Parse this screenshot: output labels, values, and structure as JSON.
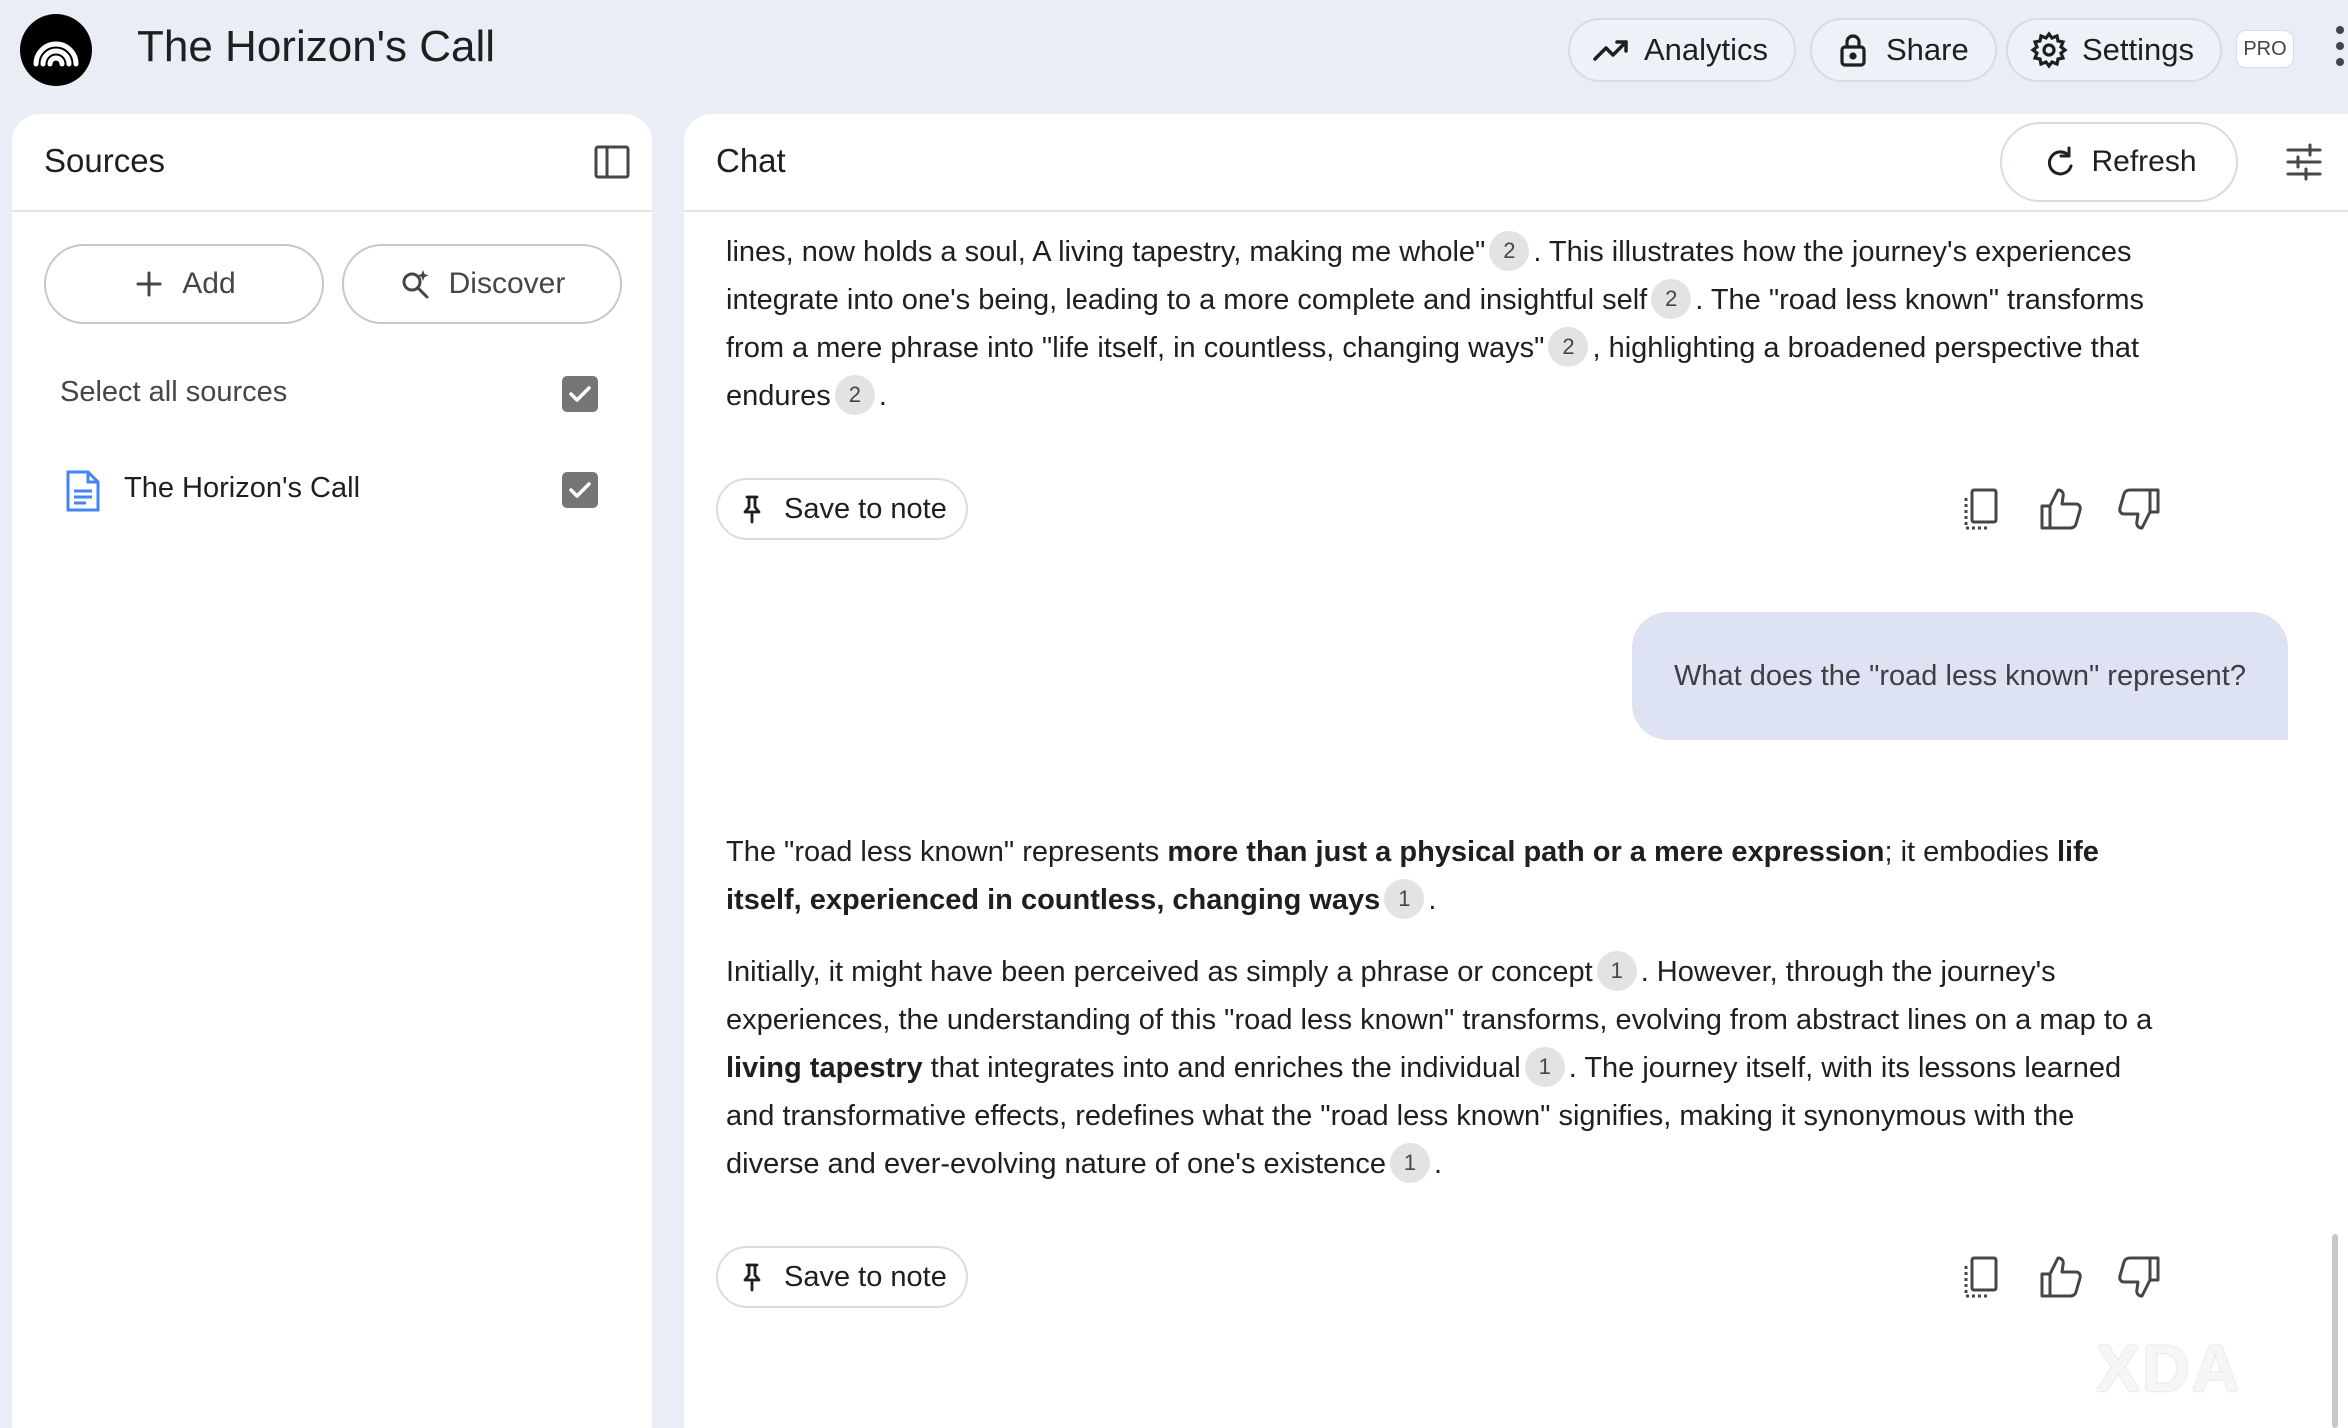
{
  "app": {
    "title": "The Horizon's Call",
    "logo_icon": "notebook-waves-logo"
  },
  "header": {
    "analytics_label": "Analytics",
    "share_label": "Share",
    "settings_label": "Settings",
    "pro_badge": "PRO"
  },
  "sources": {
    "title": "Sources",
    "add_label": "Add",
    "discover_label": "Discover",
    "select_all_label": "Select all sources",
    "select_all_checked": true,
    "items": [
      {
        "label": "The Horizon's Call",
        "checked": true,
        "icon": "document-icon"
      }
    ]
  },
  "chat": {
    "title": "Chat",
    "refresh_label": "Refresh",
    "prev_answer": {
      "t1": "lines, now holds a soul, A living tapestry, making me whole\"",
      "c1": "2",
      "t2": ". This illustrates how the journey's experiences integrate into one's being, leading to a more complete and insightful self",
      "c2": "2",
      "t3": ". The \"road less known\" transforms from a mere phrase into \"life itself, in countless, changing ways\"",
      "c3": "2",
      "t4": ", highlighting a broadened perspective that endures",
      "c4": "2",
      "t5": "."
    },
    "save_to_note_label": "Save to note",
    "user_question": "What does the \"road less known\" represent?",
    "answer_p1": {
      "t1": "The \"road less known\" represents ",
      "b1": "more than just a physical path or a mere expression",
      "t2": "; it embodies ",
      "b2": "life itself, experienced in countless, changing ways",
      "c1": "1",
      "t3": "."
    },
    "answer_p2": {
      "t1": "Initially, it might have been perceived as simply a phrase or concept",
      "c1": "1",
      "t2": ". However, through the journey's experiences, the understanding of this \"road less known\" transforms, evolving from abstract lines on a map to a ",
      "b1": "living tapestry",
      "t3": " that integrates into and enriches the individual",
      "c2": "1",
      "t4": ". The journey itself, with its lessons learned and transformative effects, redefines what the \"road less known\" signifies, making it synonymous with the diverse and ever-evolving nature of one's existence",
      "c3": "1",
      "t5": "."
    }
  },
  "watermark": "XDA"
}
